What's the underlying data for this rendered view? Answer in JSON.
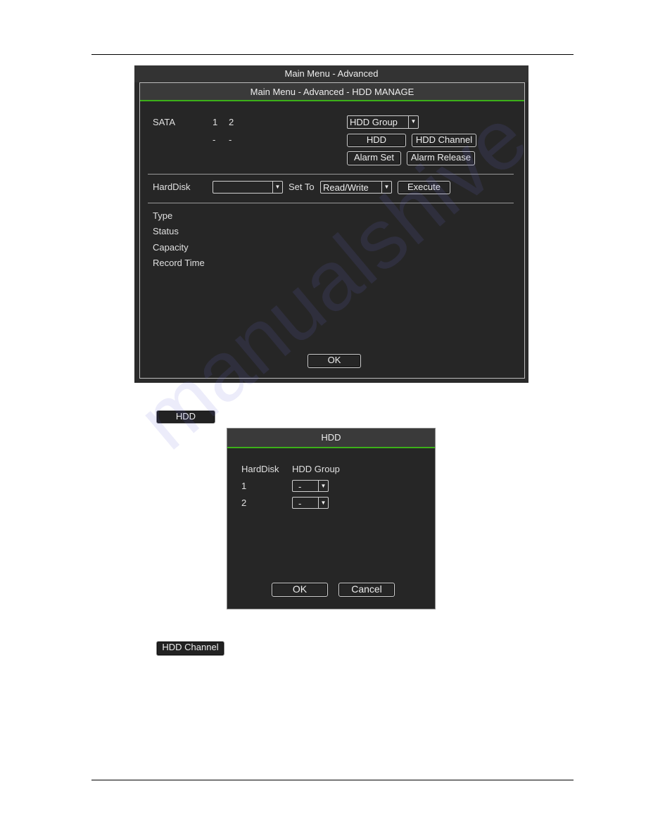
{
  "main_window": {
    "title": "Main Menu - Advanced",
    "subtitle": "Main Menu - Advanced - HDD MANAGE",
    "sata_label": "SATA",
    "sata_ports": [
      "1",
      "2"
    ],
    "sata_status": [
      "-",
      "-"
    ],
    "hdd_group_select": "HDD Group",
    "hdd_button": "HDD",
    "hdd_channel_button": "HDD Channel",
    "alarm_set_button": "Alarm Set",
    "alarm_release_button": "Alarm Release",
    "harddisk_label": "HardDisk",
    "harddisk_value": "",
    "set_to_label": "Set To",
    "set_to_value": "Read/Write",
    "execute_button": "Execute",
    "info_labels": [
      "Type",
      "Status",
      "Capacity",
      "Record Time"
    ],
    "ok_button": "OK"
  },
  "hdd_button_image": "HDD",
  "hdd_dialog": {
    "title": "HDD",
    "col_harddisk": "HardDisk",
    "col_group": "HDD Group",
    "rows": [
      {
        "disk": "1",
        "group": "-"
      },
      {
        "disk": "2",
        "group": "-"
      }
    ],
    "ok_button": "OK",
    "cancel_button": "Cancel"
  },
  "hdd_channel_button_image": "HDD Channel",
  "watermark": "manualshive",
  "colors": {
    "accent_green": "#3cb019",
    "window_bg": "#262626"
  }
}
